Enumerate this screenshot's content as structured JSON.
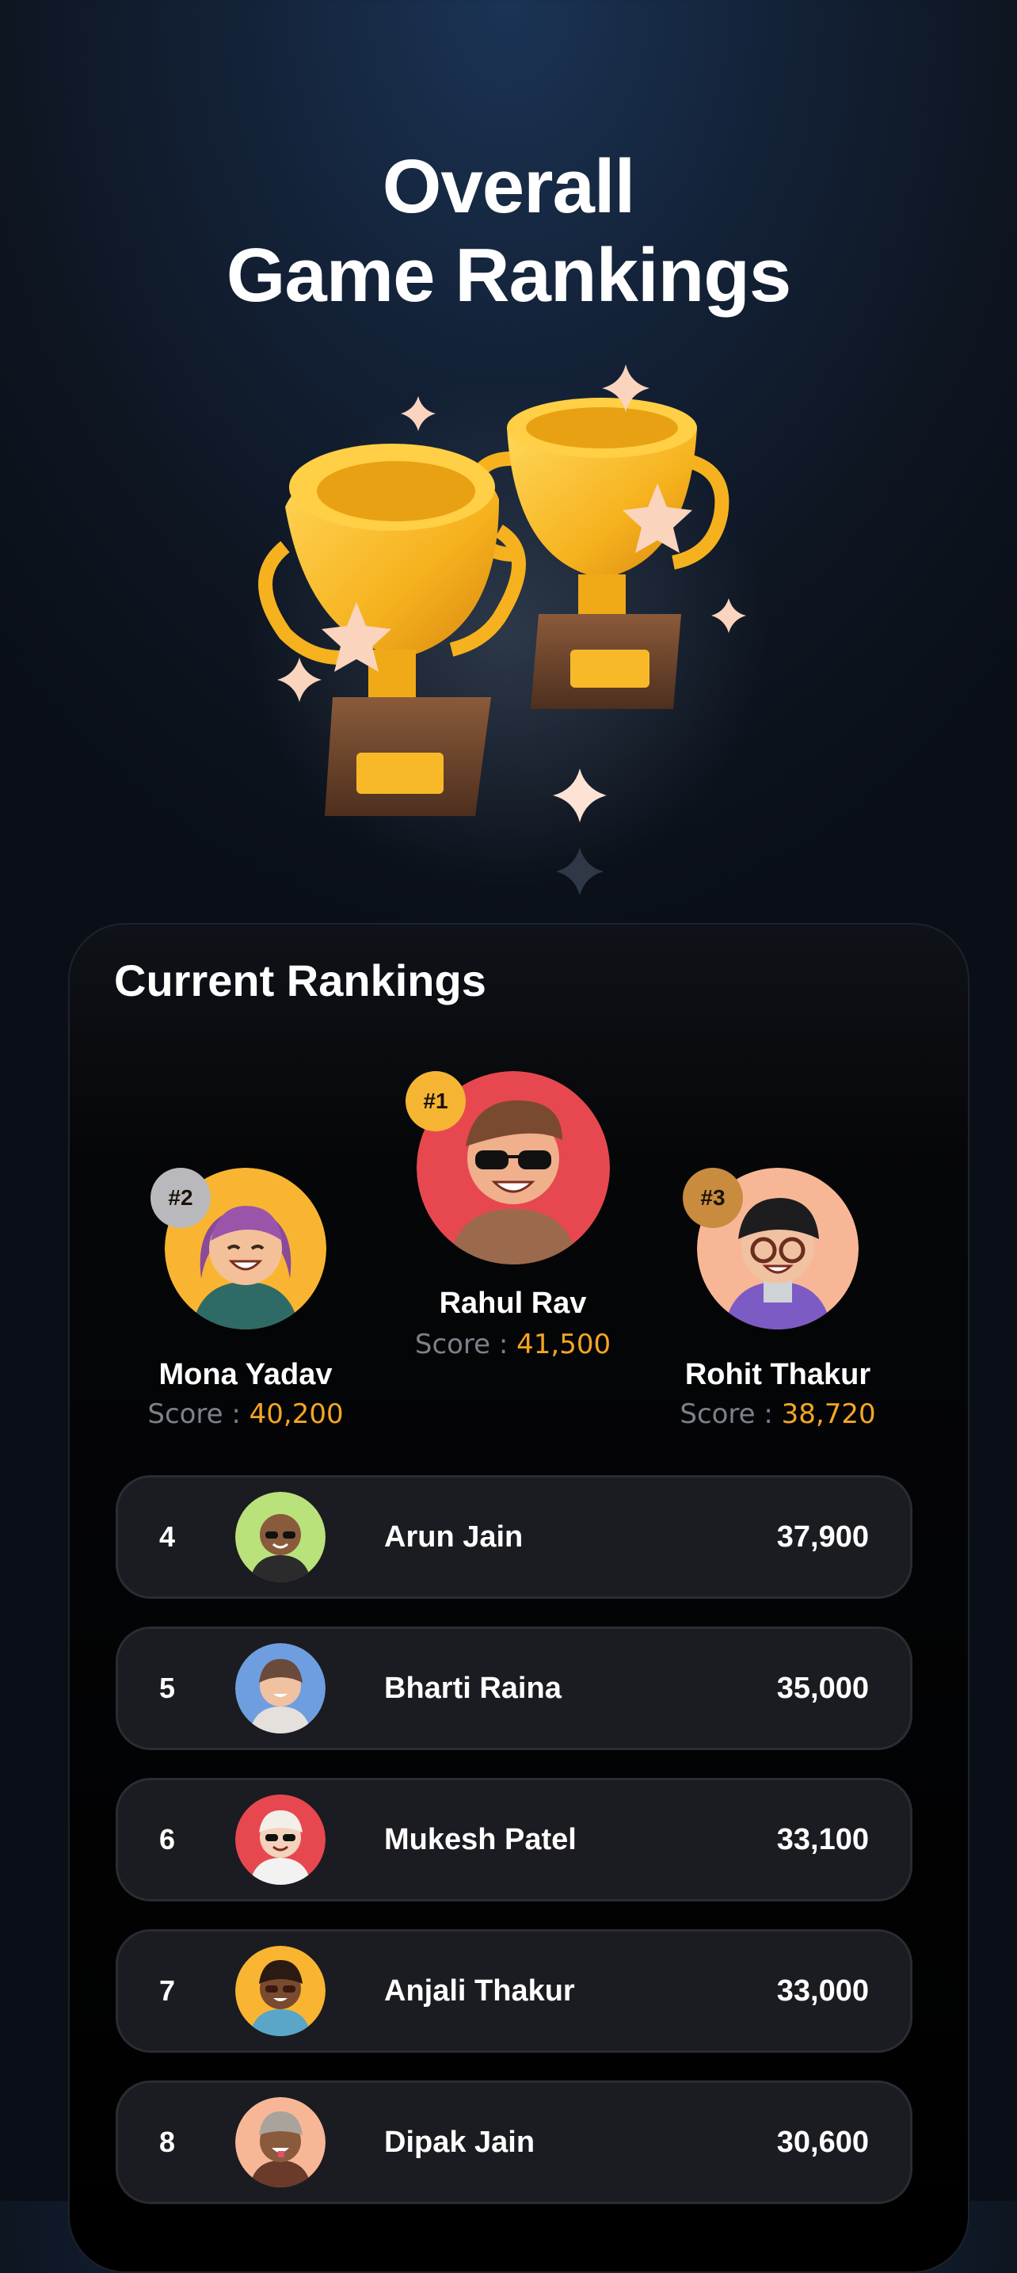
{
  "header": {
    "title_line1": "Overall",
    "title_line2": "Game Rankings"
  },
  "rankings": {
    "section_title": "Current Rankings",
    "score_label": "Score : ",
    "top3": [
      {
        "badge": "#1",
        "name": "Rahul Rav",
        "score": "41,500",
        "avatar_bg": "#e7484f"
      },
      {
        "badge": "#2",
        "name": "Mona Yadav",
        "score": "40,200",
        "avatar_bg": "#f9b531"
      },
      {
        "badge": "#3",
        "name": "Rohit Thakur",
        "score": "38,720",
        "avatar_bg": "#f7b796"
      }
    ],
    "list": [
      {
        "rank": "4",
        "name": "Arun Jain",
        "score": "37,900",
        "avatar_bg": "#b9e27a"
      },
      {
        "rank": "5",
        "name": "Bharti Raina",
        "score": "35,000",
        "avatar_bg": "#6f9ee0"
      },
      {
        "rank": "6",
        "name": "Mukesh Patel",
        "score": "33,100",
        "avatar_bg": "#e7484f"
      },
      {
        "rank": "7",
        "name": "Anjali Thakur",
        "score": "33,000",
        "avatar_bg": "#f9b531"
      },
      {
        "rank": "8",
        "name": "Dipak Jain",
        "score": "30,600",
        "avatar_bg": "#f7b796"
      }
    ]
  },
  "colors": {
    "accent": "#f5a623",
    "gold": "#f5b533",
    "silver": "#b9b9bd",
    "bronze": "#c98b3e"
  }
}
